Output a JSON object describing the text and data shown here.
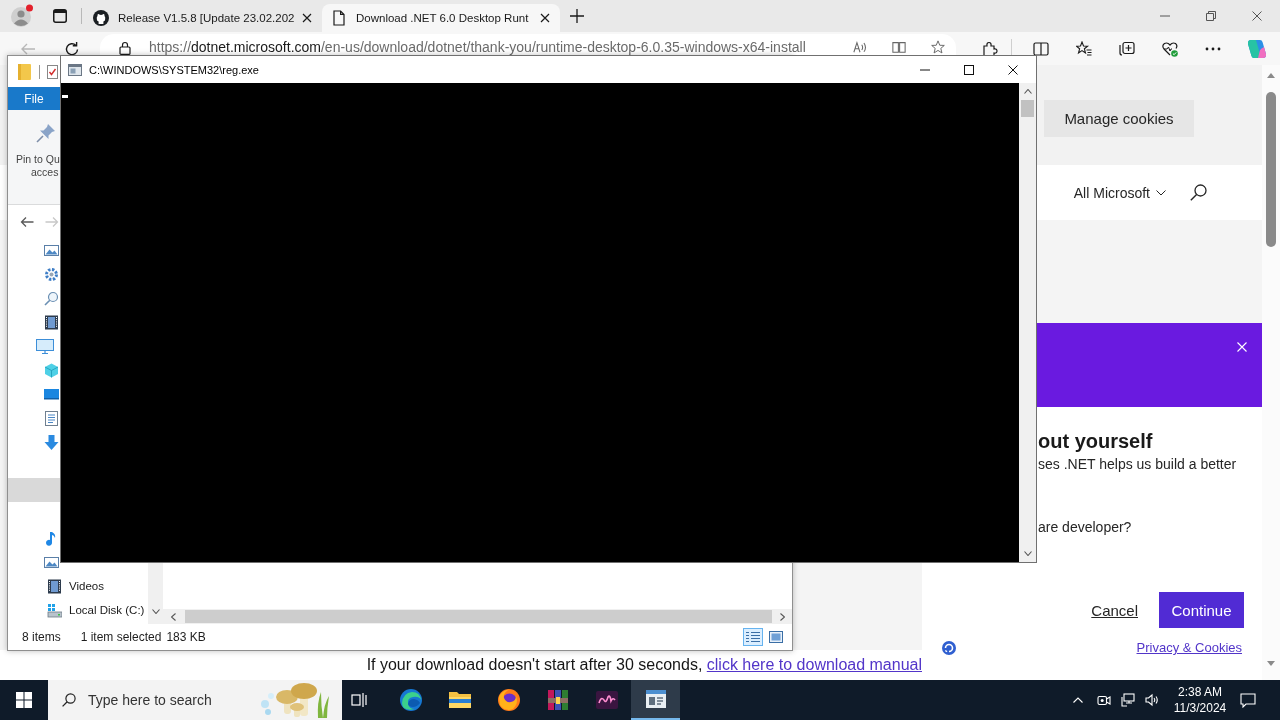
{
  "browser": {
    "tabs": [
      {
        "title": "Release V1.5.8 [Update 23.02.202",
        "selected": false
      },
      {
        "title": "Download .NET 6.0 Desktop Runt",
        "selected": true
      }
    ],
    "back_disabled": true,
    "address": {
      "scheme": "https://",
      "host": "dotnet.microsoft.com",
      "path": "/en-us/download/dotnet/thank-you/runtime-desktop-6.0.35-windows-x64-install"
    },
    "page": {
      "manage_cookies": "Manage cookies",
      "nav_menu": "All Microsoft",
      "survey": {
        "heading": "out yourself",
        "intro": "ses .NET helps us build a better",
        "question": "are developer?",
        "cancel": "Cancel",
        "continue": "Continue",
        "privacy": "Privacy & Cookies"
      },
      "footer": {
        "text": "If your download doesn't start after 30 seconds,",
        "link": "click here to download manual"
      }
    }
  },
  "explorer": {
    "ribbon_tab": "File",
    "pin_button": [
      "Pin to Qu",
      "acces"
    ],
    "forward_disabled": true,
    "nav_items": [
      {
        "selected": false
      },
      {
        "selected": false
      },
      {
        "selected": false
      },
      {
        "selected": false
      },
      {
        "selected": false
      },
      {
        "selected": false
      },
      {
        "selected": false
      },
      {
        "selected": false
      },
      {
        "selected": false
      },
      {
        "selected": false
      },
      {
        "selected": true
      },
      {
        "selected": false
      },
      {
        "selected": false
      },
      {
        "selected": false
      },
      {
        "label": "Videos",
        "selected": false
      },
      {
        "label": "Local Disk (C:)",
        "selected": false
      }
    ],
    "status": {
      "count": "8 items",
      "selection": "1 item selected",
      "size": "183 KB"
    },
    "view_buttons": [
      {
        "selected": true
      },
      {
        "selected": false
      }
    ]
  },
  "console": {
    "title": "C:\\WINDOWS\\SYSTEM32\\reg.exe"
  },
  "taskbar": {
    "search": {
      "placeholder": "Type here to search"
    },
    "apps": [
      {
        "selected": false
      },
      {
        "selected": false
      },
      {
        "selected": false
      },
      {
        "selected": false
      },
      {
        "selected": false
      },
      {
        "selected": true
      }
    ],
    "time": "2:38 AM",
    "date": "11/3/2024"
  }
}
